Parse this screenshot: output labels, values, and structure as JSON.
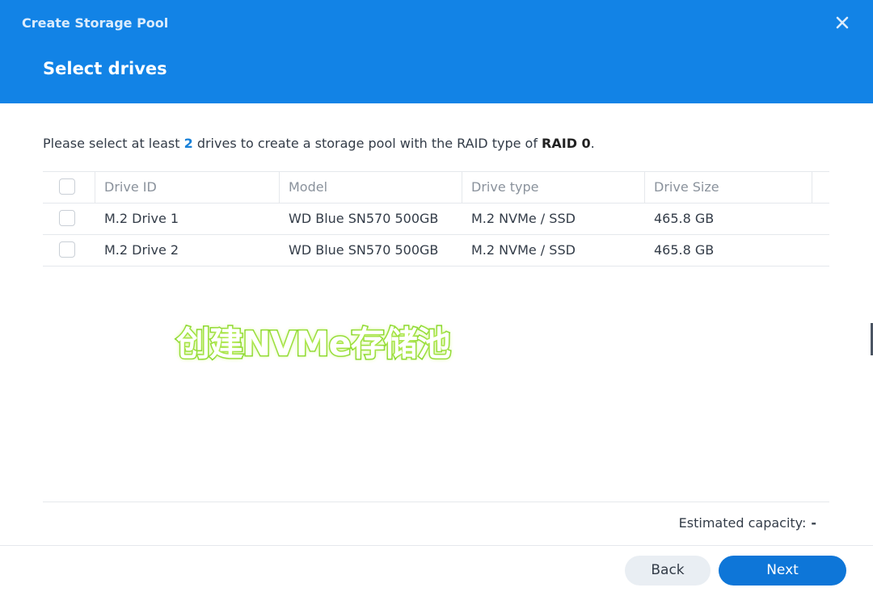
{
  "dialog": {
    "title": "Create Storage Pool",
    "step_title": "Select drives"
  },
  "instructions": {
    "prefix": "Please select at least ",
    "count": "2",
    "middle": " drives to create a storage pool with the RAID type of ",
    "raid": "RAID 0",
    "suffix": "."
  },
  "table": {
    "columns": [
      "Drive ID",
      "Model",
      "Drive type",
      "Drive Size"
    ],
    "rows": [
      {
        "id": "M.2 Drive 1",
        "model": "WD Blue SN570 500GB",
        "type": "M.2 NVMe / SSD",
        "size": "465.8 GB",
        "checked": false
      },
      {
        "id": "M.2 Drive 2",
        "model": "WD Blue SN570 500GB",
        "type": "M.2 NVMe / SSD",
        "size": "465.8 GB",
        "checked": false
      }
    ]
  },
  "overlay": {
    "caption": "创建NVMe存储池"
  },
  "footer": {
    "capacity_label": "Estimated capacity:",
    "capacity_value": "-",
    "back_label": "Back",
    "next_label": "Next"
  },
  "colors": {
    "header": "#1283e6",
    "accent": "#0e76d8",
    "highlight": "#1780d8",
    "caption_stroke": "#7ed321"
  },
  "icons": {
    "close": "close-icon"
  }
}
